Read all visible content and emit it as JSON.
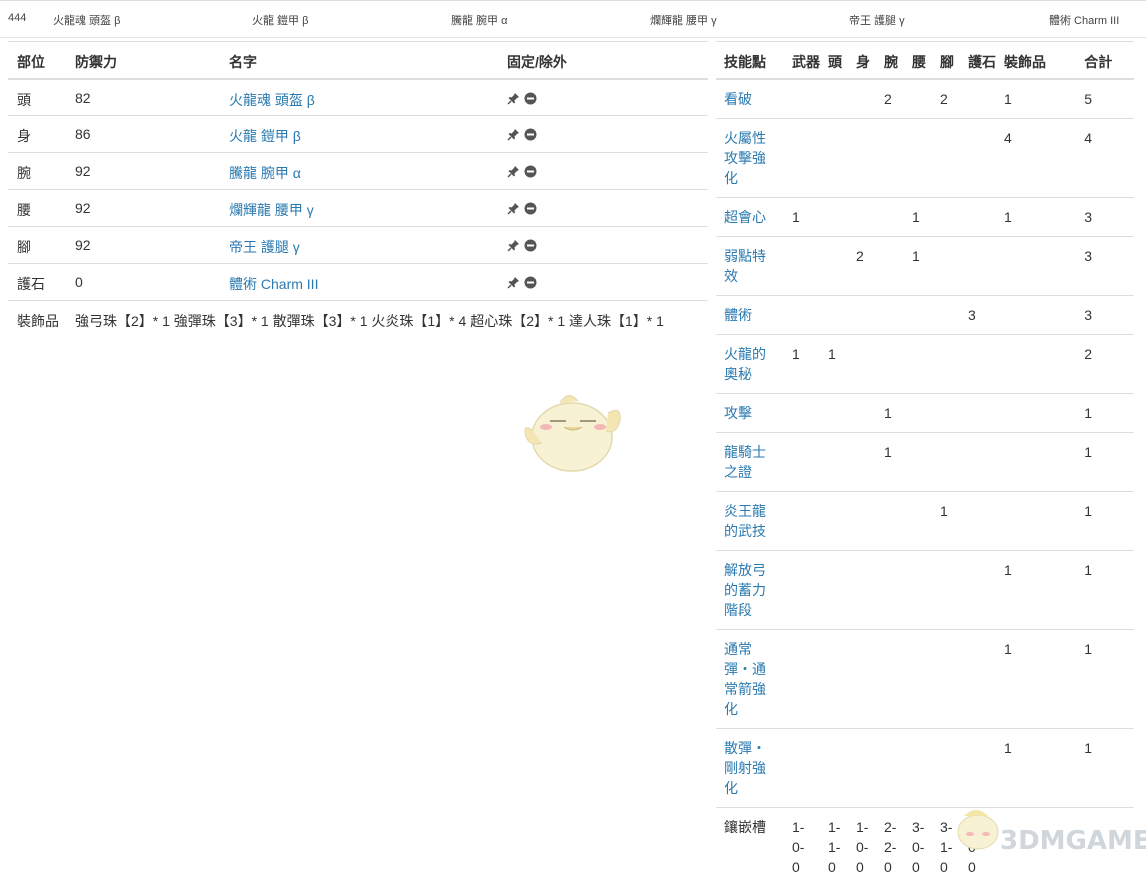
{
  "topbar": {
    "items": [
      "444",
      "火龍魂 頭盔 β",
      "火龍 鎧甲 β",
      "騰龍 腕甲 α",
      "爛輝龍 腰甲 γ",
      "帝王 護腿 γ",
      "體術 Charm III"
    ]
  },
  "equipment": {
    "headers": {
      "part": "部位",
      "defense": "防禦力",
      "name": "名字",
      "fixed": "固定/除外"
    },
    "rows": [
      {
        "part": "頭",
        "defense": "82",
        "name": "火龍魂 頭盔 β"
      },
      {
        "part": "身",
        "defense": "86",
        "name": "火龍 鎧甲 β"
      },
      {
        "part": "腕",
        "defense": "92",
        "name": "騰龍 腕甲 α"
      },
      {
        "part": "腰",
        "defense": "92",
        "name": "爛輝龍 腰甲 γ"
      },
      {
        "part": "腳",
        "defense": "92",
        "name": "帝王 護腿 γ"
      },
      {
        "part": "護石",
        "defense": "0",
        "name": "體術 Charm III"
      }
    ],
    "decorations_label": "裝飾品",
    "decorations_value": "強弓珠【2】* 1 強彈珠【3】* 1 散彈珠【3】* 1 火炎珠【1】* 4 超心珠【2】* 1 達人珠【1】* 1"
  },
  "skills": {
    "headers": [
      "技能點",
      "武器",
      "頭",
      "身",
      "腕",
      "腰",
      "腳",
      "護石",
      "裝飾品",
      "合計"
    ],
    "rows": [
      {
        "name": "看破",
        "cells": [
          "",
          "",
          "",
          "2",
          "",
          "2",
          "",
          "1",
          "5"
        ]
      },
      {
        "name": "火屬性攻擊強化",
        "cells": [
          "",
          "",
          "",
          "",
          "",
          "",
          "",
          "4",
          "4"
        ]
      },
      {
        "name": "超會心",
        "cells": [
          "1",
          "",
          "",
          "",
          "1",
          "",
          "",
          "1",
          "3"
        ]
      },
      {
        "name": "弱點特效",
        "cells": [
          "",
          "",
          "2",
          "",
          "1",
          "",
          "",
          "",
          "3"
        ]
      },
      {
        "name": "體術",
        "cells": [
          "",
          "",
          "",
          "",
          "",
          "",
          "3",
          "",
          "3"
        ]
      },
      {
        "name": "火龍的奧秘",
        "cells": [
          "1",
          "1",
          "",
          "",
          "",
          "",
          "",
          "",
          "2"
        ]
      },
      {
        "name": "攻擊",
        "cells": [
          "",
          "",
          "",
          "1",
          "",
          "",
          "",
          "",
          "1"
        ]
      },
      {
        "name": "龍騎士之證",
        "cells": [
          "",
          "",
          "",
          "1",
          "",
          "",
          "",
          "",
          "1"
        ]
      },
      {
        "name": "炎王龍的武技",
        "cells": [
          "",
          "",
          "",
          "",
          "",
          "1",
          "",
          "",
          "1"
        ]
      },
      {
        "name": "解放弓的蓄力階段",
        "cells": [
          "",
          "",
          "",
          "",
          "",
          "",
          "",
          "1",
          "1"
        ]
      },
      {
        "name": "通常彈・通常箭強化",
        "cells": [
          "",
          "",
          "",
          "",
          "",
          "",
          "",
          "1",
          "1"
        ]
      },
      {
        "name": "散彈・剛射強化",
        "cells": [
          "",
          "",
          "",
          "",
          "",
          "",
          "",
          "1",
          "1"
        ]
      }
    ],
    "slots_label": "鑲嵌槽",
    "slots": [
      "1-0-0",
      "1-1-0",
      "1-0-0",
      "2-2-0",
      "3-0-0",
      "3-1-0",
      "0-0-0"
    ]
  },
  "watermark": {
    "text": "3DMGAME"
  },
  "colors": {
    "link": "#2a7ab0",
    "border": "#dddddd",
    "icon": "#555555"
  }
}
